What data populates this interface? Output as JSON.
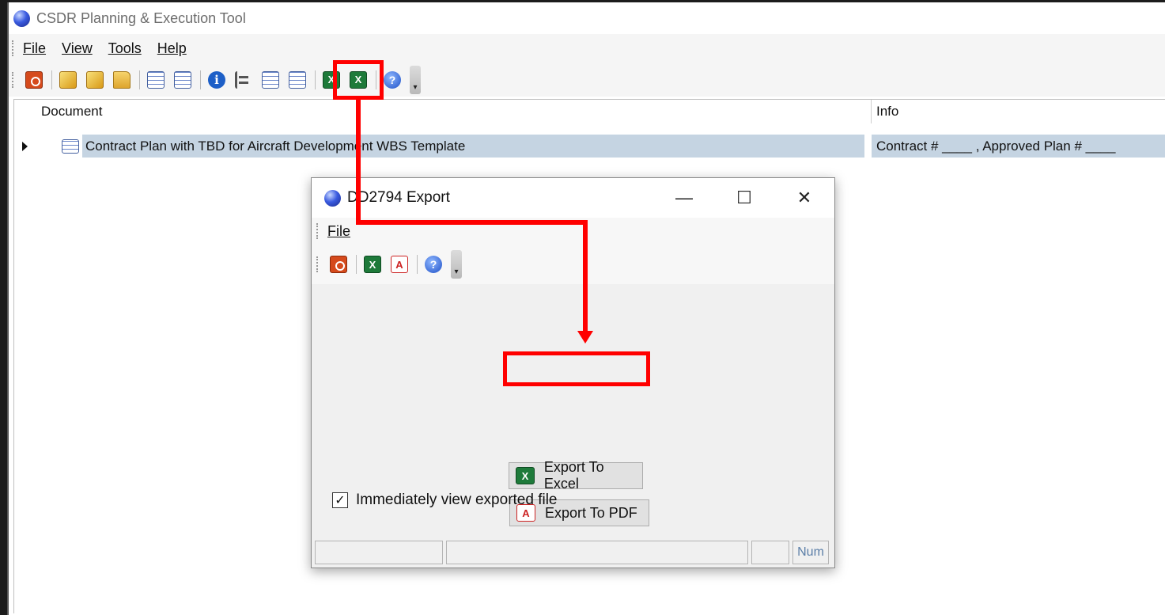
{
  "app": {
    "title": "CSDR Planning & Execution Tool",
    "menu": [
      {
        "label": "File"
      },
      {
        "label": "View"
      },
      {
        "label": "Tools"
      },
      {
        "label": "Help"
      }
    ],
    "toolbar_icons": [
      "stop-icon",
      "new-doc-icon",
      "edit-doc-icon",
      "open-folder-icon",
      "import-icon",
      "import-alt-icon",
      "info-icon",
      "tree-icon",
      "table-icon",
      "table-alt-icon",
      "export-excel-icon",
      "excel-icon",
      "help-icon"
    ]
  },
  "grid": {
    "headers": {
      "document": "Document",
      "info": "Info"
    },
    "row": {
      "document": "Contract Plan with TBD for Aircraft Development WBS Template",
      "info": "Contract # ____ , Approved Plan # ____"
    }
  },
  "dialog": {
    "title": "DD2794 Export",
    "controls": {
      "minimize": "—",
      "maximize": "☐",
      "close": "✕"
    },
    "menu": {
      "file": "File"
    },
    "export_excel": "Export To Excel",
    "export_pdf": "Export To PDF",
    "checkbox_label": "Immediately view exported file",
    "checkbox_checked": true,
    "status_num": "Num"
  },
  "colors": {
    "highlight": "#ff0000",
    "selected_row": "#c5d4e2"
  }
}
